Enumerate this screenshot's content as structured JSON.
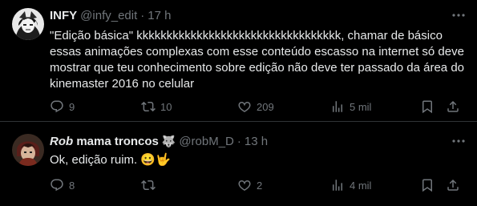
{
  "tweets": [
    {
      "name": "INFY",
      "handle": "@infy_edit",
      "separator": "·",
      "time": "17 h",
      "more_icon": "more-icon",
      "text": "\"Edição básica\" kkkkkkkkkkkkkkkkkkkkkkkkkkkkkkkkkk, chamar de básico essas animações complexas com esse conteúdo escasso na internet só deve mostrar que teu conhecimento sobre edição não deve ter passado da área do kinemaster 2016 no celular",
      "actions": {
        "replies": "9",
        "retweets": "10",
        "likes": "209",
        "views": "5 mil"
      }
    },
    {
      "name_italic": "Rob",
      "name_rest": " mama troncos",
      "name_emoji": "🐺",
      "handle": "@robM_D",
      "separator": "·",
      "time": "13 h",
      "more_icon": "more-icon",
      "text": "Ok, edição ruim. 😀🤟",
      "actions": {
        "replies": "8",
        "retweets": "",
        "likes": "2",
        "views": "4 mil"
      }
    }
  ],
  "colors": {
    "background": "#000000",
    "text": "#e7e9ea",
    "muted": "#71767b",
    "divider": "#2f3336"
  },
  "icons": [
    "reply-icon",
    "retweet-icon",
    "like-icon",
    "views-icon",
    "bookmark-icon",
    "share-icon"
  ]
}
